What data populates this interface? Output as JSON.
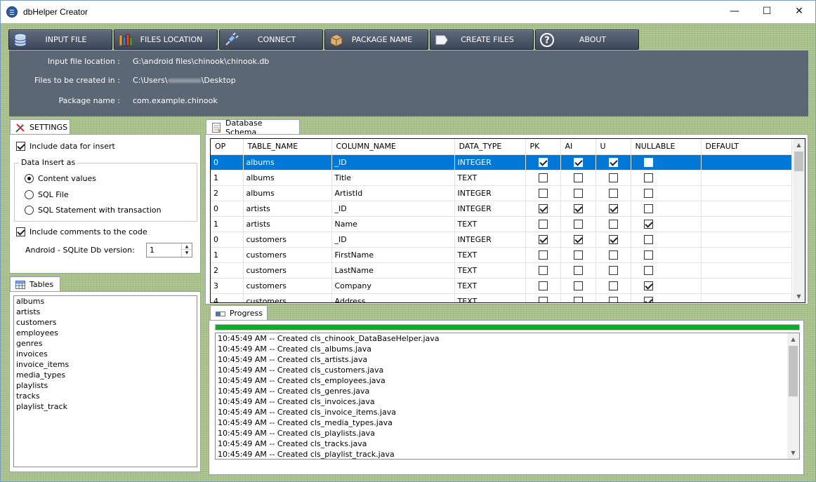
{
  "window": {
    "title": "dbHelper Creator",
    "minimize": "—",
    "maximize": "☐",
    "close": "✕"
  },
  "toolbar": [
    {
      "label": "INPUT FILE",
      "icon": "database-icon"
    },
    {
      "label": "FILES LOCATION",
      "icon": "folders-icon"
    },
    {
      "label": "CONNECT",
      "icon": "plug-icon"
    },
    {
      "label": "PACKAGE NAME",
      "icon": "package-icon"
    },
    {
      "label": "CREATE FILES",
      "icon": "file-icon"
    },
    {
      "label": "ABOUT",
      "icon": "help-icon"
    }
  ],
  "info": {
    "input_label": "Input file location :",
    "input_value": "G:\\android files\\chinook\\chinook.db",
    "files_label": "Files to be created in :",
    "files_value_prefix": "C:\\Users\\",
    "files_value_suffix": "\\Desktop",
    "package_label": "Package name :",
    "package_value": "com.example.chinook"
  },
  "settings": {
    "tab_label": "SETTINGS",
    "include_data": "Include data for insert",
    "include_data_checked": true,
    "group_title": "Data Insert as",
    "options": [
      "Content values",
      "SQL File",
      "SQL Statement with transaction"
    ],
    "selected_option": 0,
    "include_comments": "Include comments to the code",
    "include_comments_checked": true,
    "version_label": "Android - SQLite Db version:",
    "version_value": "1"
  },
  "tables": {
    "tab_label": "Tables",
    "items": [
      "albums",
      "artists",
      "customers",
      "employees",
      "genres",
      "invoices",
      "invoice_items",
      "media_types",
      "playlists",
      "tracks",
      "playlist_track"
    ]
  },
  "schema": {
    "tab_label": "Database Schema",
    "columns": [
      "OP",
      "TABLE_NAME",
      "COLUMN_NAME",
      "DATA_TYPE",
      "PK",
      "AI",
      "U",
      "NULLABLE",
      "DEFAULT"
    ],
    "rows": [
      {
        "op": "0",
        "table": "albums",
        "column": "_ID",
        "type": "INTEGER",
        "pk": true,
        "ai": true,
        "u": true,
        "nullable": false,
        "default": ""
      },
      {
        "op": "1",
        "table": "albums",
        "column": "Title",
        "type": "TEXT",
        "pk": false,
        "ai": false,
        "u": false,
        "nullable": false,
        "default": ""
      },
      {
        "op": "2",
        "table": "albums",
        "column": "ArtistId",
        "type": "INTEGER",
        "pk": false,
        "ai": false,
        "u": false,
        "nullable": false,
        "default": ""
      },
      {
        "op": "0",
        "table": "artists",
        "column": "_ID",
        "type": "INTEGER",
        "pk": true,
        "ai": true,
        "u": true,
        "nullable": false,
        "default": ""
      },
      {
        "op": "1",
        "table": "artists",
        "column": "Name",
        "type": "TEXT",
        "pk": false,
        "ai": false,
        "u": false,
        "nullable": true,
        "default": ""
      },
      {
        "op": "0",
        "table": "customers",
        "column": "_ID",
        "type": "INTEGER",
        "pk": true,
        "ai": true,
        "u": true,
        "nullable": false,
        "default": ""
      },
      {
        "op": "1",
        "table": "customers",
        "column": "FirstName",
        "type": "TEXT",
        "pk": false,
        "ai": false,
        "u": false,
        "nullable": false,
        "default": ""
      },
      {
        "op": "2",
        "table": "customers",
        "column": "LastName",
        "type": "TEXT",
        "pk": false,
        "ai": false,
        "u": false,
        "nullable": false,
        "default": ""
      },
      {
        "op": "3",
        "table": "customers",
        "column": "Company",
        "type": "TEXT",
        "pk": false,
        "ai": false,
        "u": false,
        "nullable": true,
        "default": ""
      },
      {
        "op": "4",
        "table": "customers",
        "column": "Address",
        "type": "TEXT",
        "pk": false,
        "ai": false,
        "u": false,
        "nullable": true,
        "default": ""
      }
    ],
    "selected_row": 0
  },
  "progress": {
    "tab_label": "Progress",
    "percent": 100,
    "log": [
      "10:45:49 AM -- Created cls_chinook_DataBaseHelper.java",
      "10:45:49 AM -- Created cls_albums.java",
      "10:45:49 AM -- Created cls_artists.java",
      "10:45:49 AM -- Created cls_customers.java",
      "10:45:49 AM -- Created cls_employees.java",
      "10:45:49 AM -- Created cls_genres.java",
      "10:45:49 AM -- Created cls_invoices.java",
      "10:45:49 AM -- Created cls_invoice_items.java",
      "10:45:49 AM -- Created cls_media_types.java",
      "10:45:49 AM -- Created cls_playlists.java",
      "10:45:49 AM -- Created cls_tracks.java",
      "10:45:49 AM -- Created cls_playlist_track.java"
    ]
  },
  "colors": {
    "selection": "#0078d7",
    "progress": "#06b025",
    "toolbar": "#4a5466",
    "info_panel": "#5c6776"
  }
}
